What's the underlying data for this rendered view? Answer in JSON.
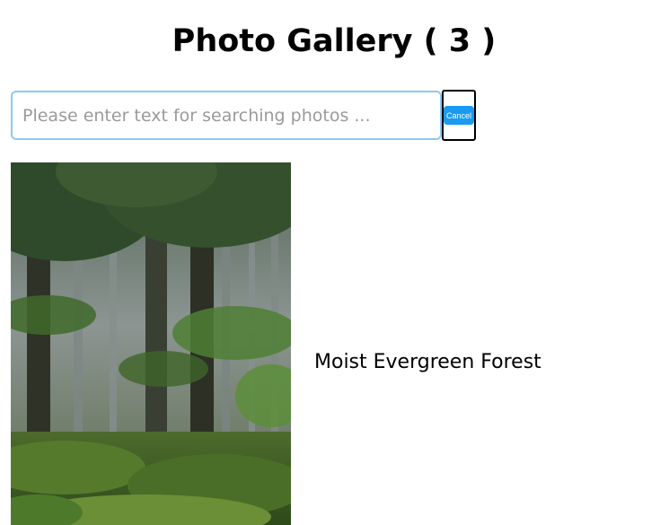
{
  "header": {
    "title": "Photo Gallery ( 3 )"
  },
  "search": {
    "placeholder": "Please enter text for searching photos ...",
    "value": "",
    "cancel_label": "Cancel"
  },
  "gallery": {
    "items": [
      {
        "caption": "Moist Evergreen Forest",
        "image_icon": "forest-photo"
      }
    ]
  },
  "colors": {
    "input_border": "#8ec8ee",
    "cancel_button": "#1a9bf0"
  }
}
